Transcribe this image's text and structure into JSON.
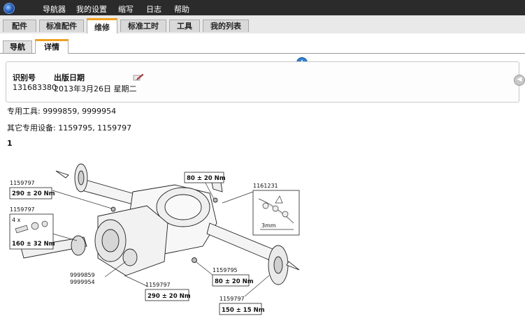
{
  "menubar": {
    "items": [
      "导航器",
      "我的设置",
      "缩写",
      "日志",
      "帮助"
    ]
  },
  "tabs": [
    "配件",
    "标准配件",
    "维修",
    "标准工时",
    "工具",
    "我的列表"
  ],
  "subtabs": [
    "导航",
    "详情"
  ],
  "info": {
    "id_label": "识别号",
    "id_value": "131683380",
    "date_label": "出版日期",
    "date_value": "2013年3月26日 星期二"
  },
  "body": {
    "special_tools": "专用工具: 9999859, 9999954",
    "other_equipment": "其它专用设备: 1159795, 1159797",
    "step": "1"
  },
  "diagram": {
    "callouts": {
      "c1_part": "1159797",
      "c1_torque": "290",
      "c2_part": "1159797",
      "c2_qty": "4 x",
      "c2_torque": "160",
      "c3_torque": "80",
      "c4_part": "1161231",
      "c4_gap": "3mm",
      "c5_part": "1159795",
      "c5_torque": "80",
      "c6_part": "1159797",
      "c6_torque": "290",
      "c7_part": "1159797",
      "c7_torque": "150",
      "tool_1": "9999859",
      "tool_2": "9999954"
    },
    "tolerance": {
      "c1": "± 20 Nm",
      "c2": "± 32 Nm",
      "c3": "± 20 Nm",
      "c5": "± 20 Nm",
      "c6": "± 20 Nm",
      "c7": "± 15 Nm"
    }
  }
}
